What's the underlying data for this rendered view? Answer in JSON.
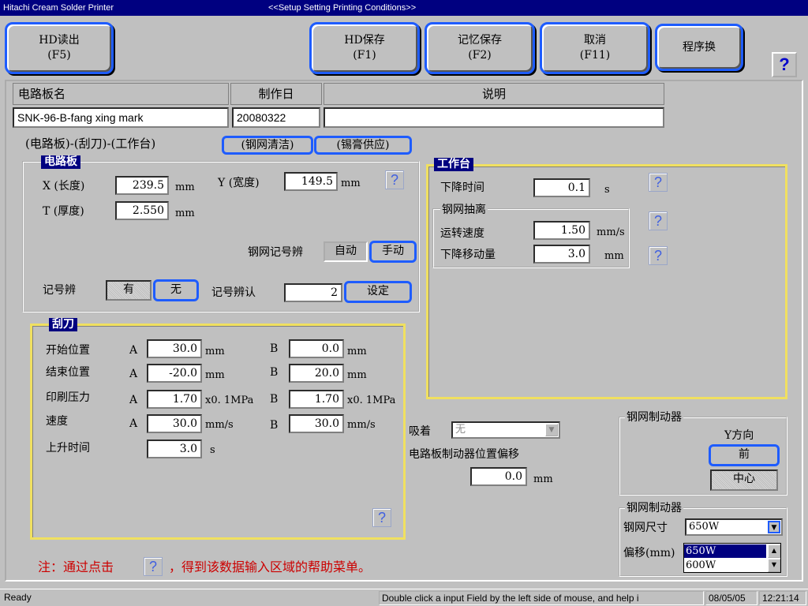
{
  "window": {
    "app_title": "Hitachi Cream Solder Printer",
    "subtitle": "<<Setup Setting Printing Conditions>>"
  },
  "toolbar": {
    "hd_read": {
      "line1": "HD读出",
      "line2": "(F5)"
    },
    "hd_save": {
      "line1": "HD保存",
      "line2": "(F1)"
    },
    "memory_save": {
      "line1": "记忆保存",
      "line2": "(F2)"
    },
    "cancel": {
      "line1": "取消",
      "line2": "(F11)"
    },
    "program_switch": "程序换",
    "help": "?"
  },
  "board_info": {
    "name_header": "电路板名",
    "date_header": "制作日",
    "desc_header": "说明",
    "name_value": "SNK-96-B-fang xing mark",
    "date_value": "20080322",
    "desc_value": ""
  },
  "tabs": {
    "breadcrumb": "(电路板)-(刮刀)-(工作台)",
    "stencil_clean": "(钢网清洁)",
    "paste_supply": "(锡膏供应)"
  },
  "pcb": {
    "title": "电路板",
    "x_label": "X (长度)",
    "x_value": "239.5",
    "x_unit": "mm",
    "y_label": "Y (宽度)",
    "y_value": "149.5",
    "y_unit": "mm",
    "t_label": "T (厚度)",
    "t_value": "2.550",
    "t_unit": "mm",
    "stencil_mark_label": "钢网记号辨",
    "auto_label": "自动",
    "manual_label": "手动",
    "mark_label": "记号辨",
    "has_label": "有",
    "none_label": "无",
    "mark_recog_label": "记号辨认",
    "mark_recog_value": "2",
    "set_label": "设定",
    "help": "?"
  },
  "squeegee": {
    "title": "刮刀",
    "a": "A",
    "b": "B",
    "rows": {
      "start": {
        "label": "开始位置",
        "a": "30.0",
        "a_unit": "mm",
        "b": "0.0",
        "b_unit": "mm"
      },
      "end": {
        "label": "结束位置",
        "a": "-20.0",
        "a_unit": "mm",
        "b": "20.0",
        "b_unit": "mm"
      },
      "pressure": {
        "label": "印刷压力",
        "a": "1.70",
        "a_unit": "x0. 1MPa",
        "b": "1.70",
        "b_unit": "x0. 1MPa"
      },
      "speed": {
        "label": "速度",
        "a": "30.0",
        "a_unit": "mm/s",
        "b": "30.0",
        "b_unit": "mm/s"
      }
    },
    "rise_label": "上升时间",
    "rise_value": "3.0",
    "rise_unit": "s",
    "help": "?"
  },
  "table": {
    "title": "工作台",
    "descend_time_label": "下降时间",
    "descend_time_value": "0.1",
    "descend_time_unit": "s",
    "separation_title": "钢网抽离",
    "run_speed_label": "运转速度",
    "run_speed_value": "1.50",
    "run_speed_unit": "mm/s",
    "descend_amount_label": "下降移动量",
    "descend_amount_value": "3.0",
    "descend_amount_unit": "mm",
    "help": "?"
  },
  "suction": {
    "label": "吸着",
    "value": "无",
    "offset_label": "电路板制动器位置偏移",
    "offset_value": "0.0",
    "offset_unit": "mm"
  },
  "stopper_dir": {
    "title": "钢网制动器",
    "dir_label": "Y方向",
    "front": "前",
    "center": "中心"
  },
  "stopper_size": {
    "title": "钢网制动器",
    "size_label": "钢网尺寸",
    "size_value": "650W",
    "offset_label": "偏移(mm)",
    "options": [
      "650W",
      "600W"
    ]
  },
  "note": {
    "prefix": "注：通过点击",
    "icon": "?",
    "suffix": "，得到该数据输入区域的帮助菜单。"
  },
  "status": {
    "ready": "Ready",
    "message": "Double click a input Field by the left side of mouse, and help i",
    "date": "08/05/05",
    "time": "12:21:14"
  }
}
